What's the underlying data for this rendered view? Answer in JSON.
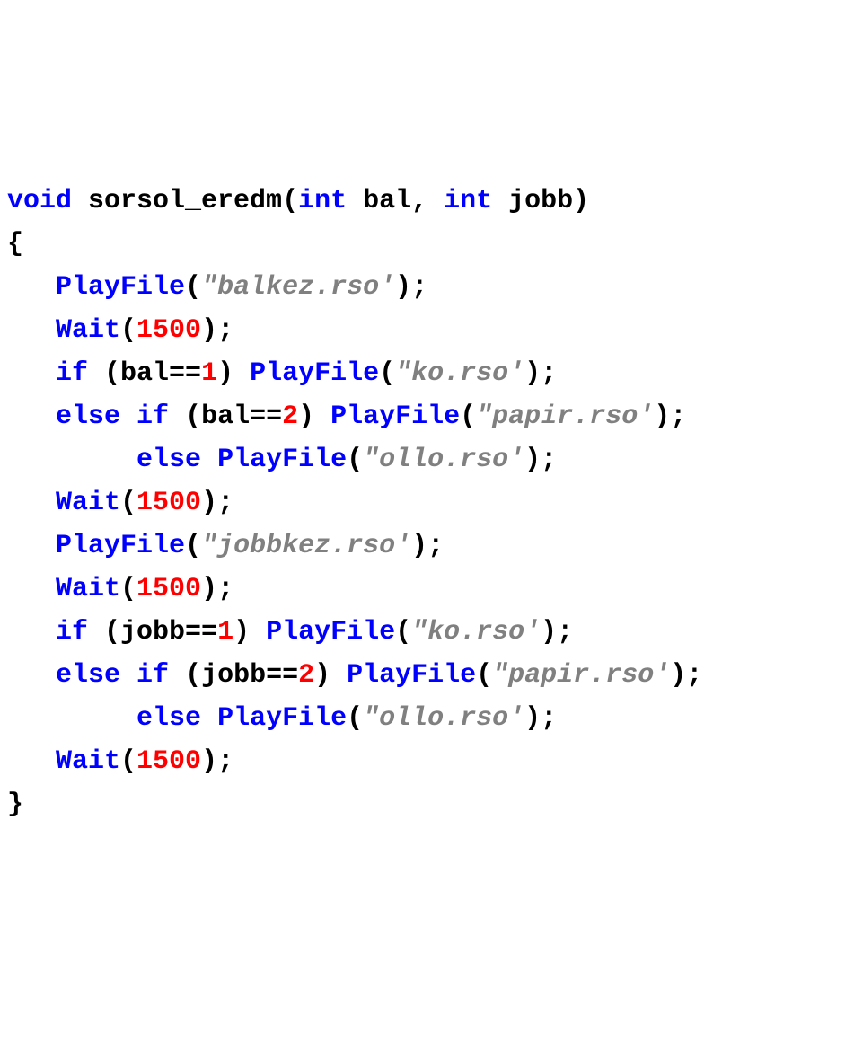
{
  "code": {
    "l1_kw_void": "void",
    "l1_name": " sorsol_eredm",
    "l1_open": "(",
    "l1_kw_int1": "int",
    "l1_p1": " bal, ",
    "l1_kw_int2": "int",
    "l1_p2": " jobb",
    "l1_close": ")",
    "l2_brace": "{",
    "l3_indent": "   ",
    "l3_fn": "PlayFile",
    "l3_open": "(",
    "l3_str": "\"balkez.rso'",
    "l3_close": ");",
    "l4_indent": "   ",
    "l4_fn": "Wait",
    "l4_open": "(",
    "l4_num": "1500",
    "l4_close": ");",
    "l5_indent": "   ",
    "l5_if": "if",
    "l5_cond_open": " (bal==",
    "l5_num": "1",
    "l5_cond_close": ") ",
    "l5_fn": "PlayFile",
    "l5_open": "(",
    "l5_str": "\"ko.rso'",
    "l5_close": ");",
    "l6_indent": "   ",
    "l6_else": "else",
    "l6_sp": " ",
    "l6_if": "if",
    "l6_cond_open": " (bal==",
    "l6_num": "2",
    "l6_cond_close": ") ",
    "l6_fn": "PlayFile",
    "l6_open": "(",
    "l6_str": "\"papir.rso'",
    "l6_close": ");",
    "l7_indent": "        ",
    "l7_else": "else",
    "l7_sp": " ",
    "l7_fn": "PlayFile",
    "l7_open": "(",
    "l7_str": "\"ollo.rso'",
    "l7_close": ");",
    "l8_indent": "   ",
    "l8_fn": "Wait",
    "l8_open": "(",
    "l8_num": "1500",
    "l8_close": ");",
    "l9_indent": "   ",
    "l9_fn": "PlayFile",
    "l9_open": "(",
    "l9_str": "\"jobbkez.rso'",
    "l9_close": ");",
    "l10_indent": "   ",
    "l10_fn": "Wait",
    "l10_open": "(",
    "l10_num": "1500",
    "l10_close": ");",
    "l11_indent": "   ",
    "l11_if": "if",
    "l11_cond_open": " (jobb==",
    "l11_num": "1",
    "l11_cond_close": ") ",
    "l11_fn": "PlayFile",
    "l11_open": "(",
    "l11_str": "\"ko.rso'",
    "l11_close": ");",
    "l12_indent": "   ",
    "l12_else": "else",
    "l12_sp": " ",
    "l12_if": "if",
    "l12_cond_open": " (jobb==",
    "l12_num": "2",
    "l12_cond_close": ") ",
    "l12_fn": "PlayFile",
    "l12_open": "(",
    "l12_str": "\"papir.rso'",
    "l12_close": ");",
    "l13_indent": "        ",
    "l13_else": "else",
    "l13_sp": " ",
    "l13_fn": "PlayFile",
    "l13_open": "(",
    "l13_str": "\"ollo.rso'",
    "l13_close": ");",
    "l14_indent": "   ",
    "l14_fn": "Wait",
    "l14_open": "(",
    "l14_num": "1500",
    "l14_close": ");",
    "l15_brace": "}"
  }
}
